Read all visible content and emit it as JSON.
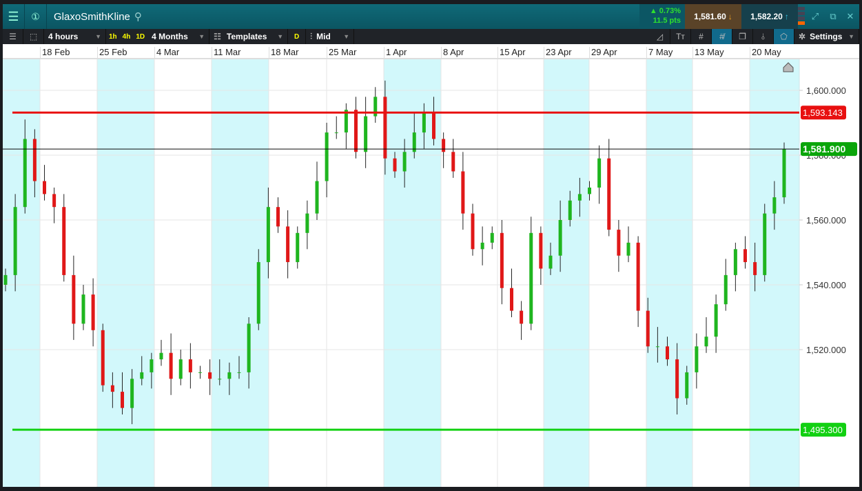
{
  "header": {
    "instrument": "GlaxoSmithKline",
    "change_pct": "▲ 0.73%",
    "change_pts": "11.5 pts",
    "sell_price": "1,581.60",
    "buy_price": "1,582.20"
  },
  "toolbar": {
    "interval": "4 hours",
    "quick": [
      "1h",
      "4h",
      "1D"
    ],
    "range": "4 Months",
    "templates": "Templates",
    "d": "D",
    "price_type": "Mid",
    "settings": "Settings"
  },
  "x_labels": [
    "18 Feb",
    "25 Feb",
    "4 Mar",
    "11 Mar",
    "18 Mar",
    "25 Mar",
    "1 Apr",
    "8 Apr",
    "15 Apr",
    "23 Apr",
    "29 Apr",
    "7 May",
    "13 May",
    "20 May"
  ],
  "chart_data": {
    "type": "candlestick",
    "y_ticks": [
      "1,600.000",
      "1,580.000",
      "1,560.000",
      "1,540.000",
      "1,520.000"
    ],
    "y_tick_values": [
      1600,
      1580,
      1560,
      1540,
      1520
    ],
    "ylim": [
      1482,
      1611
    ],
    "levels": [
      {
        "label": "1,593.143",
        "value": 1593.143,
        "color": "#e81010"
      },
      {
        "label": "1,581.900",
        "value": 1581.9,
        "color": "#0a0a0a",
        "badge": "#0aa50a"
      },
      {
        "label": "1,495.300",
        "value": 1495.3,
        "color": "#12d012"
      }
    ],
    "closes": [
      1543,
      1564,
      1585,
      1572,
      1568,
      1564,
      1543,
      1528,
      1537,
      1526,
      1509,
      1507,
      1502,
      1511,
      1513,
      1517,
      1519,
      1511,
      1517,
      1513,
      1513,
      1511,
      1511,
      1513,
      1513,
      1528,
      1547,
      1564,
      1558,
      1547,
      1556,
      1562,
      1572,
      1587,
      1587,
      1594,
      1581,
      1592,
      1598,
      1579,
      1575,
      1581,
      1587,
      1593,
      1585,
      1581,
      1575,
      1562,
      1551,
      1553,
      1556,
      1539,
      1532,
      1528,
      1556,
      1545,
      1549,
      1560,
      1566,
      1568,
      1570,
      1579,
      1557,
      1549,
      1553,
      1532,
      1521,
      1521,
      1517,
      1505,
      1513,
      1521,
      1524,
      1534,
      1543,
      1551,
      1547,
      1543,
      1562,
      1567,
      1581.9
    ],
    "colors": {
      "up": "#1fb51f",
      "down": "#e01818"
    }
  }
}
